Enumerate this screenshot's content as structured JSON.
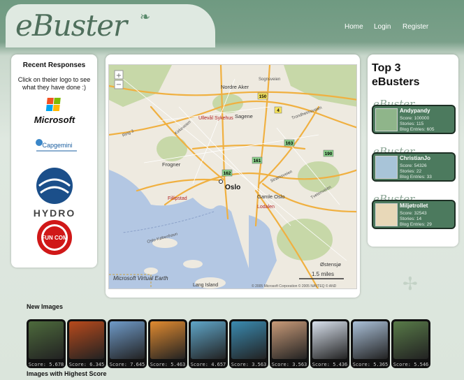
{
  "header": {
    "logo": "eBuster",
    "nav": [
      "Home",
      "Login",
      "Register"
    ]
  },
  "recent": {
    "title": "Recent Responses",
    "subtitle": "Click on theier logo to see what they have done :)",
    "companies": [
      "Microsoft",
      "Capgemini",
      "HYDRO",
      "FUN COM"
    ]
  },
  "map": {
    "city": "Oslo",
    "places": [
      "Nordre Aker",
      "Sagene",
      "Ullevål Sykehus",
      "Frogner",
      "Fillipstad",
      "Gamle Oslo",
      "Lodalen",
      "Østensjø",
      "Lang Island"
    ],
    "roads": [
      "Ring 3",
      "Sognsveien",
      "Trondheimsveien",
      "Kirkeveien",
      "Strømsveien",
      "Tvetenveien",
      "Oslo-København"
    ],
    "markers": [
      "150",
      "4",
      "163",
      "161",
      "162",
      "190"
    ],
    "scale": "1.5 miles",
    "brand": "Microsoft Virtual Earth",
    "copyright": "© 2005 Microsoft Corporation © 2005 NAVTEQ © AND"
  },
  "top3": {
    "title": "Top 3 eBusters",
    "card_logo": "eBuster",
    "users": [
      {
        "name": "Andypandy",
        "score": "Score: 100000",
        "stories": "Stories: 115",
        "blog": "Blog Entries: 605",
        "avatar_color": "#8fb58a"
      },
      {
        "name": "ChristianJo",
        "score": "Score: 54326",
        "stories": "Stories: 22",
        "blog": "Blog Entries: 33",
        "avatar_color": "#a8c4d8"
      },
      {
        "name": "Miljøtrollet",
        "score": "Score: 32543",
        "stories": "Stories: 14",
        "blog": "Blog Entries: 29",
        "avatar_color": "#e8d8b8"
      }
    ]
  },
  "images": {
    "new_title": "New Images",
    "high_title": "Images with Highest Score",
    "thumbs": [
      {
        "score": "Score: 5.678",
        "color": "#4d6a3c"
      },
      {
        "score": "Score: 6.345",
        "color": "#b84a1c"
      },
      {
        "score": "Score: 7.645",
        "color": "#6f9ac8"
      },
      {
        "score": "Score: 5.463",
        "color": "#e08a30"
      },
      {
        "score": "Score: 4.657",
        "color": "#5fa5c8"
      },
      {
        "score": "Score: 3.563",
        "color": "#3a8ab0"
      },
      {
        "score": "Score: 3.563",
        "color": "#c89a78"
      },
      {
        "score": "Score: 5.436",
        "color": "#d8e0ec"
      },
      {
        "score": "Score: 5.365",
        "color": "#aac0d8"
      },
      {
        "score": "Score: 5.546",
        "color": "#587a48"
      }
    ]
  }
}
